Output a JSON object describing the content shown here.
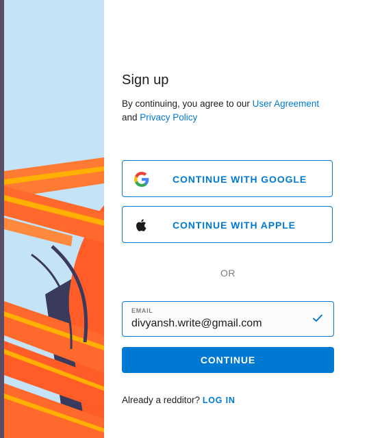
{
  "signup": {
    "title": "Sign up",
    "agreement_prefix": "By continuing, you agree to our ",
    "user_agreement_link": "User Agreement",
    "agreement_and": "and ",
    "privacy_policy_link": "Privacy Policy"
  },
  "oauth": {
    "google_label": "CONTINUE WITH GOOGLE",
    "google_icon": "google-icon",
    "apple_label": "CONTINUE WITH APPLE",
    "apple_icon": "apple-icon"
  },
  "divider": {
    "or_label": "OR"
  },
  "email": {
    "label": "EMAIL",
    "value": "divyansh.write@gmail.com",
    "status_icon": "checkmark-icon"
  },
  "continue": {
    "label": "CONTINUE"
  },
  "footer": {
    "prompt": "Already a redditor? ",
    "login_label": "LOG IN"
  },
  "colors": {
    "accent": "#0079d3",
    "art_background": "#c4e3f6",
    "art_orange": "#ff6c2f",
    "art_yellow": "#ffb000",
    "art_navy": "#3a3a5c"
  }
}
